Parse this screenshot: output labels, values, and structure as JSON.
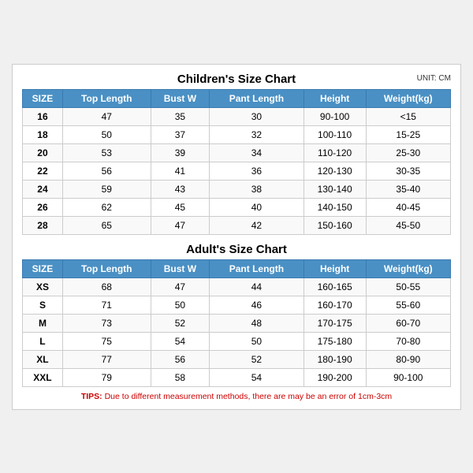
{
  "children": {
    "title": "Children's Size Chart",
    "unit": "UNIT: CM",
    "headers": [
      "SIZE",
      "Top Length",
      "Bust W",
      "Pant Length",
      "Height",
      "Weight(kg)"
    ],
    "rows": [
      [
        "16",
        "47",
        "35",
        "30",
        "90-100",
        "<15"
      ],
      [
        "18",
        "50",
        "37",
        "32",
        "100-110",
        "15-25"
      ],
      [
        "20",
        "53",
        "39",
        "34",
        "110-120",
        "25-30"
      ],
      [
        "22",
        "56",
        "41",
        "36",
        "120-130",
        "30-35"
      ],
      [
        "24",
        "59",
        "43",
        "38",
        "130-140",
        "35-40"
      ],
      [
        "26",
        "62",
        "45",
        "40",
        "140-150",
        "40-45"
      ],
      [
        "28",
        "65",
        "47",
        "42",
        "150-160",
        "45-50"
      ]
    ]
  },
  "adults": {
    "title": "Adult's Size Chart",
    "headers": [
      "SIZE",
      "Top Length",
      "Bust W",
      "Pant Length",
      "Height",
      "Weight(kg)"
    ],
    "rows": [
      [
        "XS",
        "68",
        "47",
        "44",
        "160-165",
        "50-55"
      ],
      [
        "S",
        "71",
        "50",
        "46",
        "160-170",
        "55-60"
      ],
      [
        "M",
        "73",
        "52",
        "48",
        "170-175",
        "60-70"
      ],
      [
        "L",
        "75",
        "54",
        "50",
        "175-180",
        "70-80"
      ],
      [
        "XL",
        "77",
        "56",
        "52",
        "180-190",
        "80-90"
      ],
      [
        "XXL",
        "79",
        "58",
        "54",
        "190-200",
        "90-100"
      ]
    ]
  },
  "tips": {
    "label": "TIPS:",
    "text": " Due to different measurement methods, there are may be an error of 1cm-3cm"
  }
}
